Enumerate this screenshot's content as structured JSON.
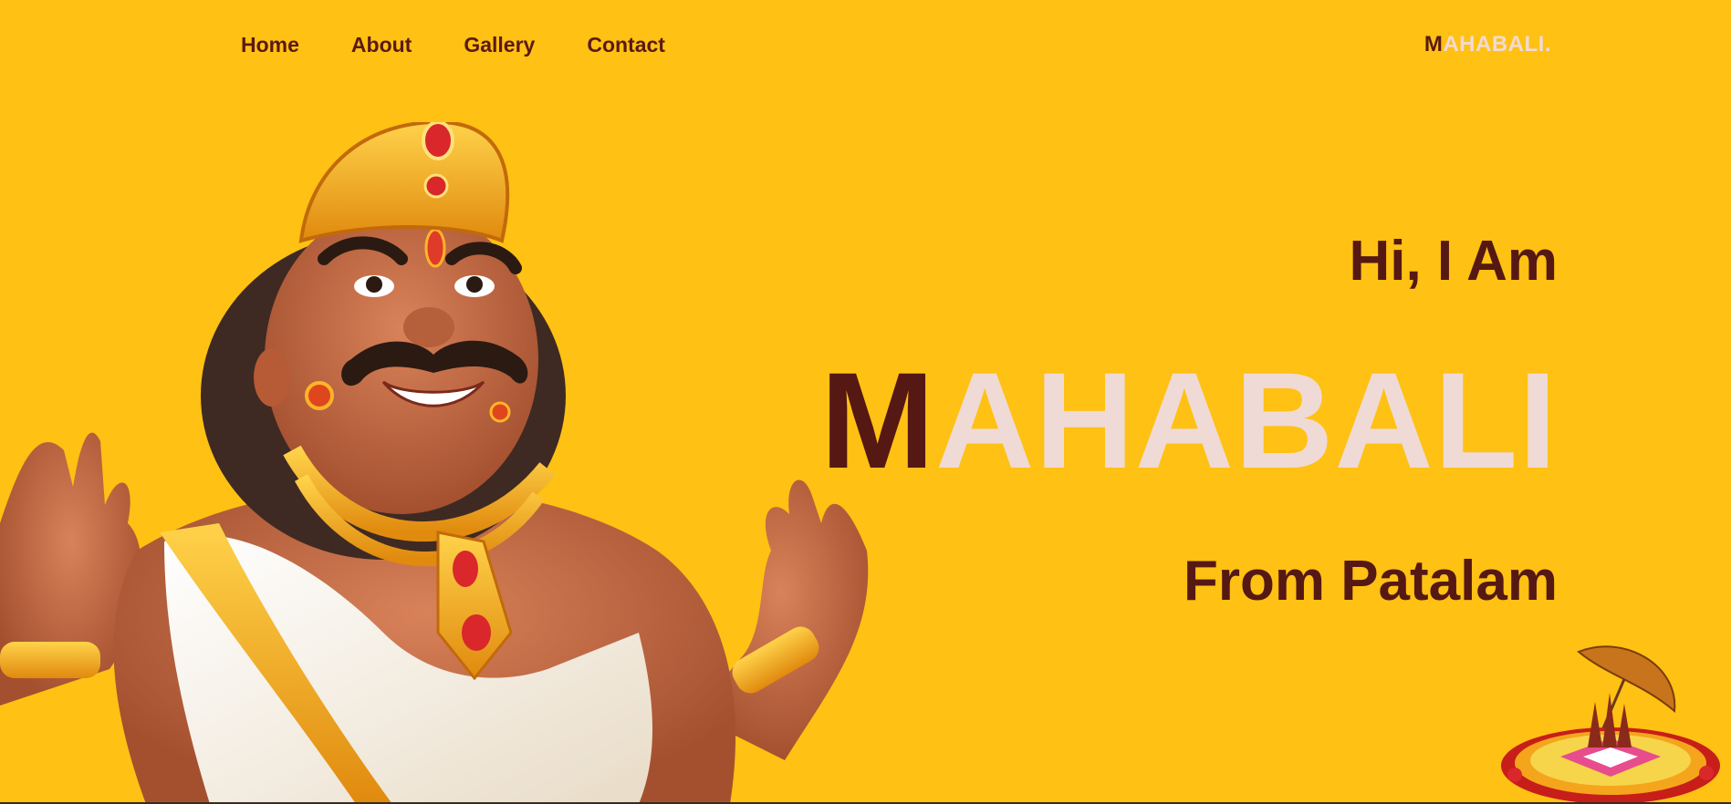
{
  "nav": {
    "items": [
      {
        "label": "Home"
      },
      {
        "label": "About"
      },
      {
        "label": "Gallery"
      },
      {
        "label": "Contact"
      }
    ]
  },
  "logo": {
    "first": "M",
    "rest": "AHABALI."
  },
  "hero": {
    "greeting": "Hi, I Am",
    "name_first": "M",
    "name_rest": "AHABALI",
    "subtitle": "From Patalam"
  },
  "colors": {
    "background": "#FFC113",
    "primary_text": "#561812",
    "light_text": "#F0DAD5"
  },
  "images": {
    "character": "king-mahabali-illustration",
    "decoration": "pookalam-with-umbrella-illustration"
  }
}
